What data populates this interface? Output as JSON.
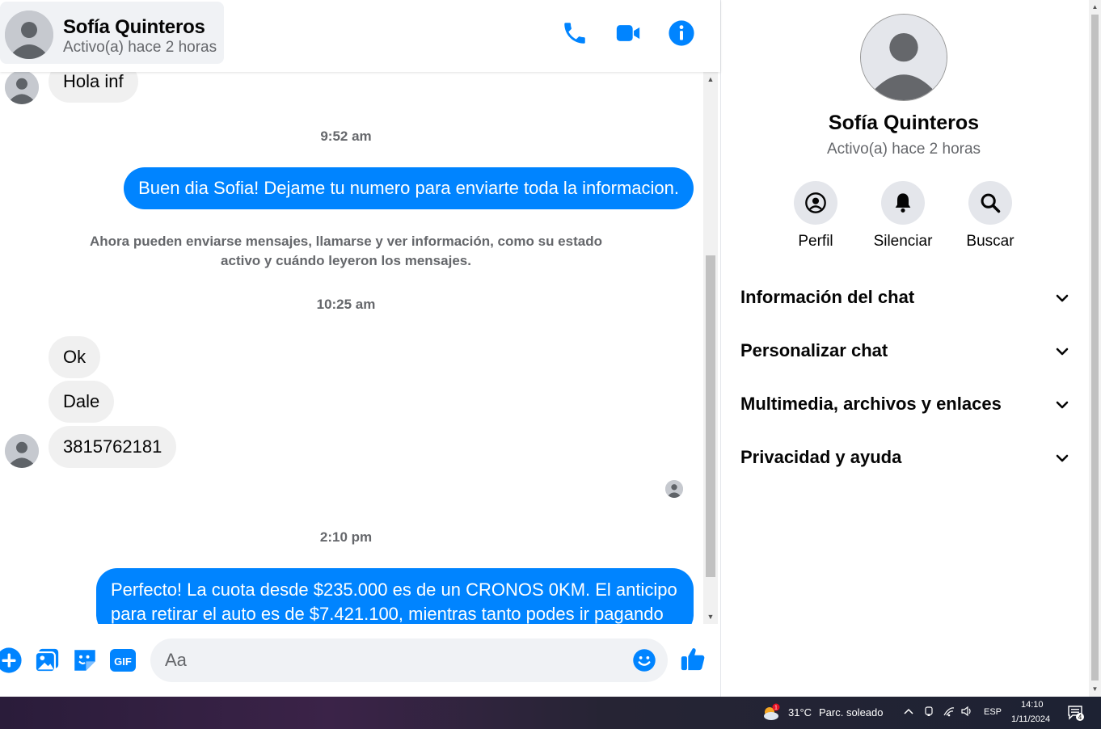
{
  "contact": {
    "name": "Sofía Quinteros",
    "status": "Activo(a) hace 2 horas"
  },
  "header_icons": [
    "phone-icon",
    "video-camera-icon",
    "info-icon"
  ],
  "messages": {
    "m1": "Hola inf",
    "t1": "9:52 am",
    "m2": "Buen dia Sofia! Dejame tu numero para enviarte toda la informacion.",
    "system": "Ahora pueden enviarse mensajes, llamarse y ver información, como su estado activo y cuándo leyeron los mensajes.",
    "t2": "10:25 am",
    "m3": "Ok",
    "m4": "Dale",
    "m5": "3815762181",
    "t3": "2:10 pm",
    "m6": "Perfecto! La cuota desde $235.000 es de un CRONOS 0KM. El anticipo para retirar el auto es de $7.421.100, mientras tanto podes ir pagando"
  },
  "composer": {
    "placeholder": "Aa",
    "icons": [
      "plus-icon",
      "image-icon",
      "sticker-icon",
      "gif-icon",
      "emoji-icon",
      "thumbs-up-icon"
    ],
    "gif_label": "GIF"
  },
  "panel": {
    "actions": {
      "profile": "Perfil",
      "mute": "Silenciar",
      "search": "Buscar"
    },
    "sections": {
      "chat_info": "Información del chat",
      "customize": "Personalizar chat",
      "media": "Multimedia, archivos y enlaces",
      "privacy": "Privacidad y ayuda"
    }
  },
  "taskbar": {
    "temperature": "31°C",
    "weather": "Parc. soleado",
    "weather_badge": "1",
    "language": "ESP",
    "time": "14:10",
    "date": "1/11/2024",
    "notifications": "4"
  },
  "colors": {
    "accent": "#0084ff",
    "bubble_in": "#f0f0f0",
    "secondary_text": "#65676b"
  }
}
